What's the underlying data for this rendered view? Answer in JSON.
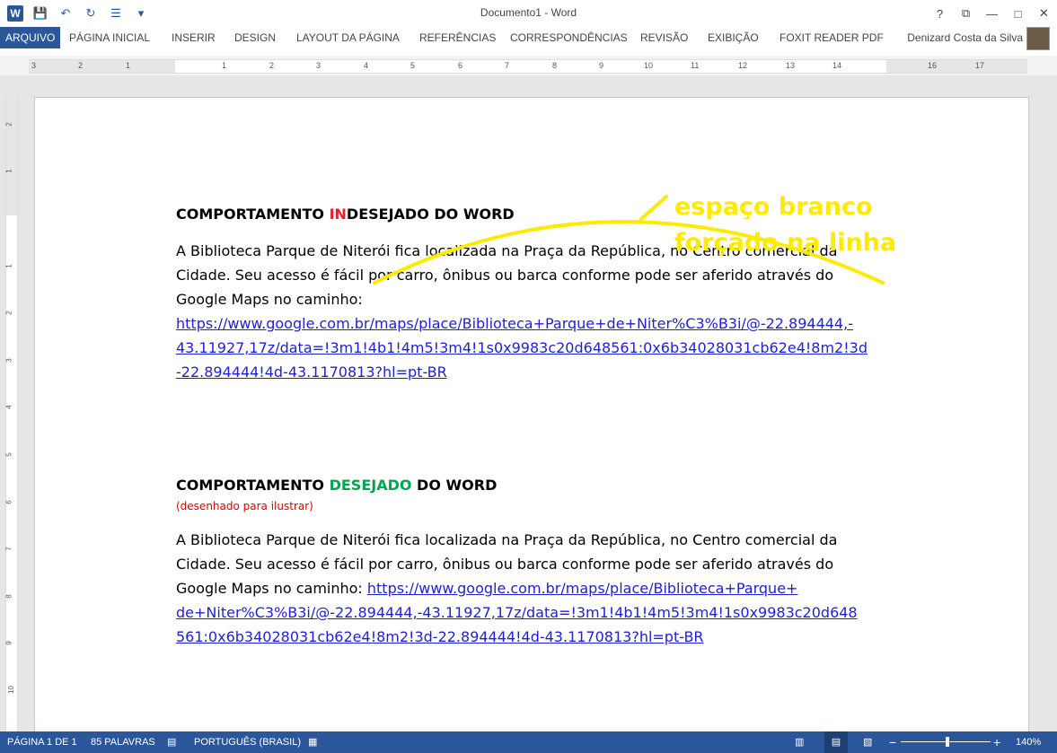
{
  "window": {
    "title": "Documento1 - Word",
    "controls": {
      "help": "?",
      "options": "⧉",
      "minimize": "—",
      "maximize": "□",
      "close": "✕"
    }
  },
  "qat": {
    "logo": "W",
    "save": "💾",
    "undo": "↶",
    "redo": "↻",
    "format": "☰",
    "more": "▾"
  },
  "ribbon": {
    "tabs": [
      "ARQUIVO",
      "PÁGINA INICIAL",
      "INSERIR",
      "DESIGN",
      "LAYOUT DA PÁGINA",
      "REFERÊNCIAS",
      "CORRESPONDÊNCIAS",
      "REVISÃO",
      "EXIBIÇÃO",
      "FOXIT READER PDF"
    ],
    "user": "Denizard Costa da Silva"
  },
  "ruler": {
    "tab_selector": "L",
    "numbers": [
      "3",
      "2",
      "1",
      "1",
      "2",
      "3",
      "4",
      "5",
      "6",
      "7",
      "8",
      "9",
      "10",
      "11",
      "12",
      "13",
      "14",
      "15",
      "16",
      "17"
    ],
    "vertical_numbers": [
      "2",
      "1",
      "1",
      "2",
      "3",
      "4",
      "5",
      "6",
      "7",
      "8",
      "9",
      "10"
    ]
  },
  "document": {
    "section1": {
      "heading_pre": "COMPORTAMENTO ",
      "heading_highlight": "IN",
      "heading_post": "DESEJADO DO WORD",
      "line1": "A Biblioteca Parque de Niterói fica localizada na Praça da República, no Centro comercial da",
      "line2": "Cidade. Seu acesso é fácil por carro, ônibus ou barca conforme pode ser aferido através do",
      "line3": "Google Maps no caminho:",
      "url_line1": "https://www.google.com.br/maps/place/Biblioteca+Parque+de+Niter%C3%B3i/@-22.894444,-",
      "url_line2": "43.11927,17z/data=!3m1!4b1!4m5!3m4!1s0x9983c20d648561:0x6b34028031cb62e4!8m2!3d",
      "url_line3": "-22.894444!4d-43.1170813?hl=pt-BR"
    },
    "section2": {
      "heading_pre": "COMPORTAMENTO ",
      "heading_highlight": "DESEJADO",
      "heading_post": " DO WORD",
      "note": "(desenhado para ilustrar)",
      "line1": "A Biblioteca Parque de Niterói fica localizada na Praça da República, no Centro comercial da",
      "line2": "Cidade. Seu acesso é fácil por carro, ônibus ou barca conforme pode ser aferido através do",
      "line3_text": "Google Maps no caminho: ",
      "url_line1": "https://www.google.com.br/maps/place/Biblioteca+Parque+",
      "url_line2": "de+Niter%C3%B3i/@-22.894444,-43.11927,17z/data=!3m1!4b1!4m5!3m4!1s0x9983c20d648",
      "url_line3": "561:0x6b34028031cb62e4!8m2!3d-22.894444!4d-43.1170813?hl=pt-BR"
    },
    "annotation": {
      "line1": "espaço branco",
      "line2": "forçado na linha",
      "color": "#ffea00"
    }
  },
  "statusbar": {
    "page": "PÁGINA 1 DE 1",
    "words": "85 PALAVRAS",
    "language": "PORTUGUÊS (BRASIL)",
    "zoom": "140%",
    "zoom_minus": "−",
    "zoom_plus": "+"
  },
  "colors": {
    "accent": "#2b579a",
    "link": "#1f1fd6",
    "red": "#e8202a",
    "green": "#00a550"
  }
}
